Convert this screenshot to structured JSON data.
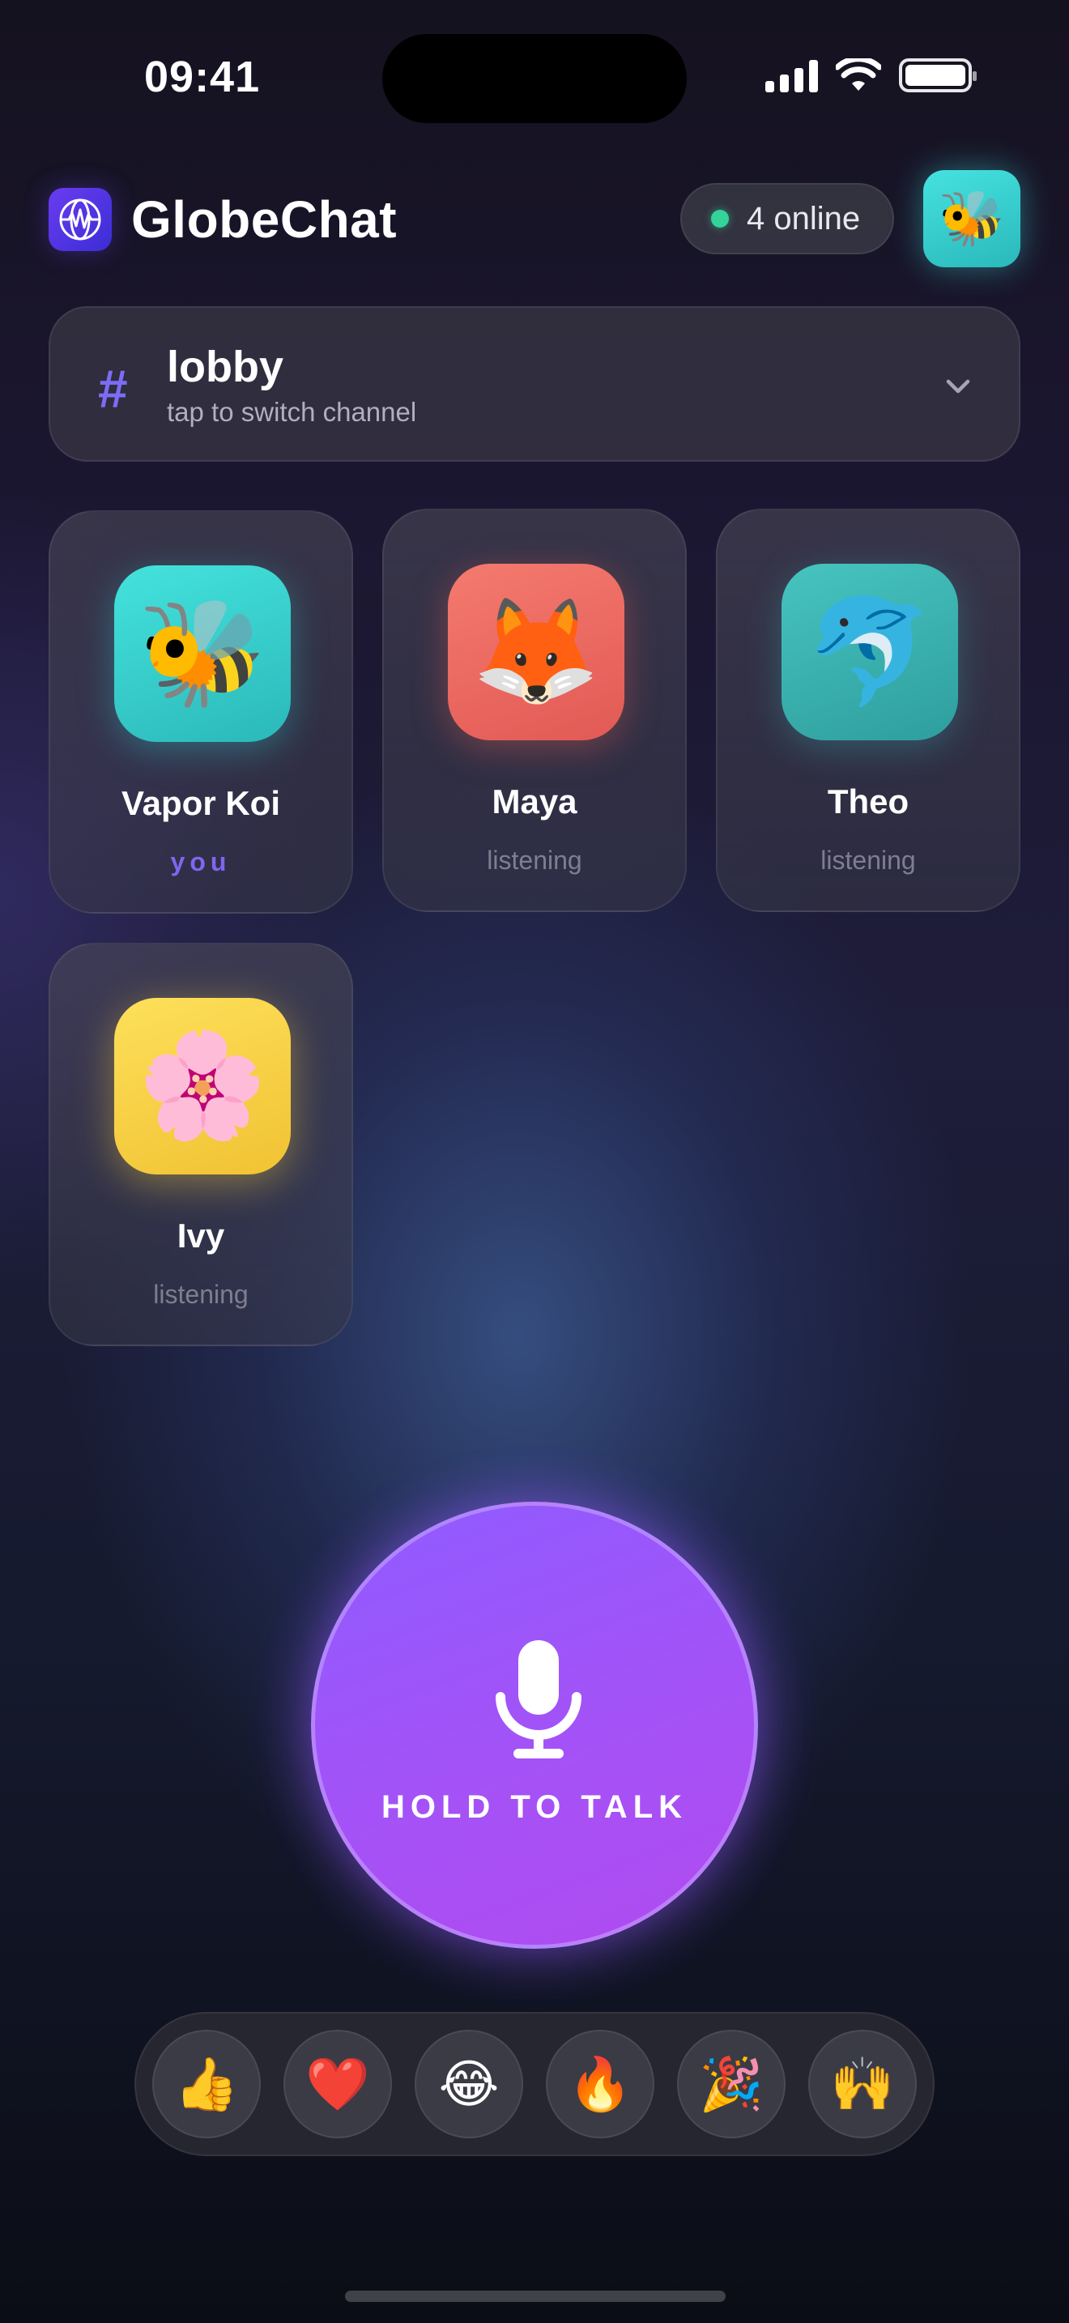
{
  "status_bar": {
    "time": "09:41"
  },
  "header": {
    "app_title": "GlobeChat",
    "online_text": "4 online",
    "self_avatar_emoji": "🐝",
    "icons": {
      "logo": "globe-waveform-icon",
      "status": "green-dot"
    }
  },
  "channel": {
    "hash": "#",
    "name": "lobby",
    "subtitle": "tap to switch channel"
  },
  "participants": [
    {
      "emoji": "🐝",
      "name": "Vapor Koi",
      "state": "you"
    },
    {
      "emoji": "🦊",
      "name": "Maya",
      "state": "listening"
    },
    {
      "emoji": "🐬",
      "name": "Theo",
      "state": "listening"
    },
    {
      "emoji": "🌸",
      "name": "Ivy",
      "state": "listening"
    }
  ],
  "talk_button": {
    "label": "HOLD TO TALK",
    "icon": "microphone-icon"
  },
  "reactions": [
    {
      "emoji": "👍",
      "name": "thumbs-up"
    },
    {
      "emoji": "❤️",
      "name": "heart"
    },
    {
      "emoji": "😂",
      "name": "laughing"
    },
    {
      "emoji": "🔥",
      "name": "fire"
    },
    {
      "emoji": "🎉",
      "name": "party"
    },
    {
      "emoji": "🙌",
      "name": "raised-hands"
    }
  ],
  "colors": {
    "accent": "#8f5cff",
    "online": "#33d39a",
    "you_label": "#7f66ee"
  }
}
